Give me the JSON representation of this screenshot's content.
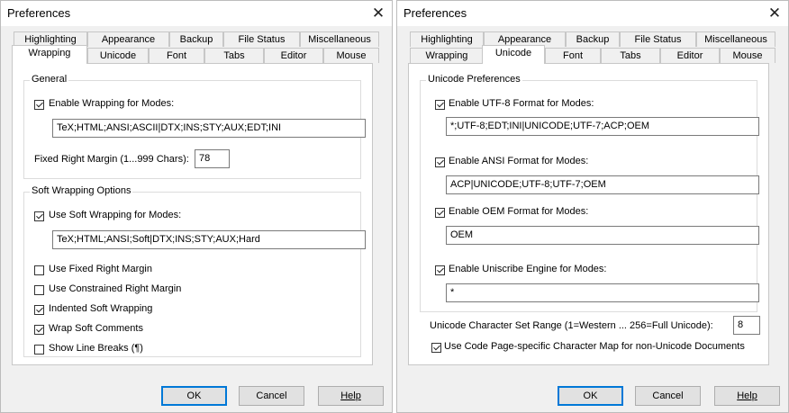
{
  "wrapping": {
    "title": "Preferences",
    "close": "✕",
    "tabs_row1": [
      "Highlighting",
      "Appearance",
      "Backup",
      "File Status",
      "Miscellaneous"
    ],
    "tabs_row2": [
      "Wrapping",
      "Unicode",
      "Font",
      "Tabs",
      "Editor",
      "Mouse"
    ],
    "general": {
      "legend": "General",
      "enable_wrapping": {
        "label": "Enable Wrapping for Modes:",
        "checked": true
      },
      "modes_value": "TeX;HTML;ANSI;ASCII|DTX;INS;STY;AUX;EDT;INI",
      "margin_label": "Fixed Right Margin (1...999 Chars):",
      "margin_value": "78"
    },
    "soft": {
      "legend": "Soft Wrapping Options",
      "use_soft": {
        "label": "Use Soft Wrapping for Modes:",
        "checked": true
      },
      "modes_value": "TeX;HTML;ANSI;Soft|DTX;INS;STY;AUX;Hard",
      "options": [
        {
          "label": "Use Fixed Right Margin",
          "checked": false
        },
        {
          "label": "Use Constrained Right Margin",
          "checked": false
        },
        {
          "label": "Indented Soft Wrapping",
          "checked": true
        },
        {
          "label": "Wrap Soft Comments",
          "checked": true
        },
        {
          "label": "Show Line Breaks (¶)",
          "checked": false
        }
      ]
    }
  },
  "unicode": {
    "title": "Preferences",
    "close": "✕",
    "tabs_row1": [
      "Highlighting",
      "Appearance",
      "Backup",
      "File Status",
      "Miscellaneous"
    ],
    "tabs_row2": [
      "Wrapping",
      "Unicode",
      "Font",
      "Tabs",
      "Editor",
      "Mouse"
    ],
    "legend": "Unicode Preferences",
    "rows": [
      {
        "label": "Enable UTF-8 Format for Modes:",
        "checked": true,
        "value": "*;UTF-8;EDT;INI|UNICODE;UTF-7;ACP;OEM"
      },
      {
        "label": "Enable ANSI Format for Modes:",
        "checked": true,
        "value": "ACP|UNICODE;UTF-8;UTF-7;OEM"
      },
      {
        "label": "Enable OEM Format for Modes:",
        "checked": true,
        "value": "OEM"
      },
      {
        "label": "Enable Uniscribe Engine for Modes:",
        "checked": true,
        "value": "*"
      }
    ],
    "range_label": "Unicode Character Set Range (1=Western ... 256=Full Unicode):",
    "range_value": "8",
    "codepage": {
      "label": "Use Code Page-specific Character Map for non-Unicode Documents",
      "checked": true
    }
  },
  "buttons": {
    "ok": "OK",
    "cancel": "Cancel",
    "help": "Help"
  }
}
